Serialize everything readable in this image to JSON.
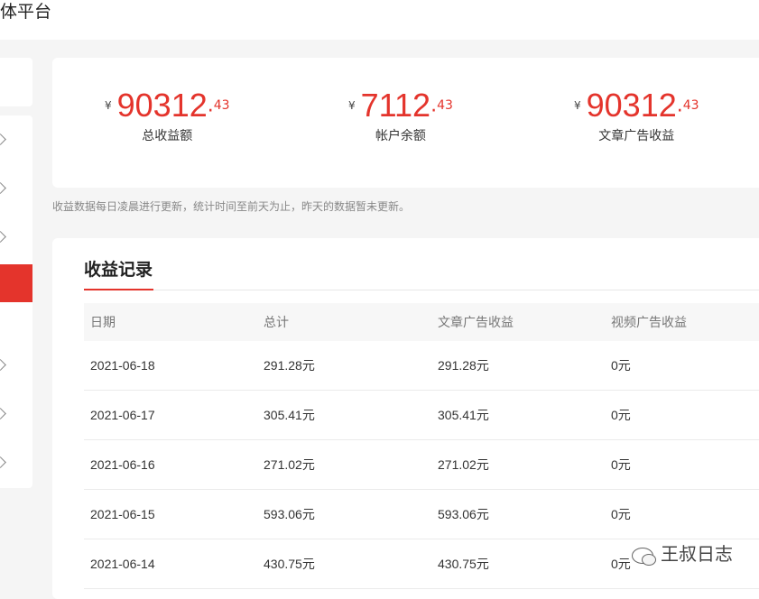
{
  "header": {
    "brand": "体平台"
  },
  "stats": [
    {
      "currency": "¥",
      "integer": "90312",
      "dot": ".",
      "decimal": "43",
      "label": "总收益额"
    },
    {
      "currency": "¥",
      "integer": "7112",
      "dot": ".",
      "decimal": "43",
      "label": "帐户余额"
    },
    {
      "currency": "¥",
      "integer": "90312",
      "dot": ".",
      "decimal": "43",
      "label": "文章广告收益"
    }
  ],
  "note": "收益数据每日凌晨进行更新，统计时间至前天为止，昨天的数据暂未更新。",
  "records": {
    "title": "收益记录",
    "columns": [
      "日期",
      "总计",
      "文章广告收益",
      "视频广告收益"
    ],
    "rows": [
      [
        "2021-06-18",
        "291.28元",
        "291.28元",
        "0元"
      ],
      [
        "2021-06-17",
        "305.41元",
        "305.41元",
        "0元"
      ],
      [
        "2021-06-16",
        "271.02元",
        "271.02元",
        "0元"
      ],
      [
        "2021-06-15",
        "593.06元",
        "593.06元",
        "0元"
      ],
      [
        "2021-06-14",
        "430.75元",
        "430.75元",
        "0元"
      ]
    ]
  },
  "watermark": {
    "icon": "wechat-icon",
    "text": "王叔日志"
  },
  "colors": {
    "accent": "#e4342c"
  }
}
